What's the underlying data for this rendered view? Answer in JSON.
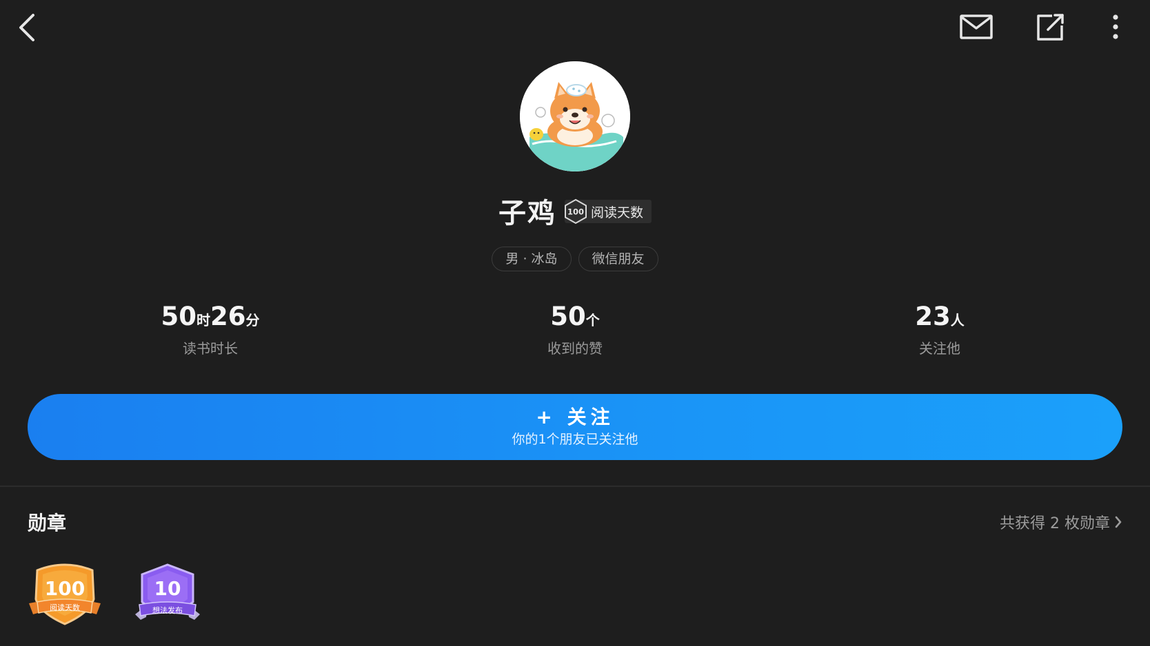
{
  "topbar": {
    "back_icon": "chevron-left-icon",
    "mail_icon": "mail-icon",
    "share_icon": "share-external-icon",
    "more_icon": "more-vertical-icon"
  },
  "profile": {
    "name": "子鸡",
    "badge_number": "100",
    "badge_label": "阅读天数",
    "tags": [
      "男 · 冰岛",
      "微信朋友"
    ]
  },
  "stats": [
    {
      "value1": "50",
      "unit1": "时",
      "value2": "26",
      "unit2": "分",
      "label": "读书时长"
    },
    {
      "value1": "50",
      "unit1": "个",
      "label": "收到的赞"
    },
    {
      "value1": "23",
      "unit1": "人",
      "label": "关注他"
    }
  ],
  "follow": {
    "label": "+ 关注",
    "subtitle": "你的1个朋友已关注他"
  },
  "medals": {
    "title": "勋章",
    "summary": "共获得 2 枚勋章",
    "items": [
      {
        "number": "100",
        "label": "阅读天数",
        "color": "#f59a2a"
      },
      {
        "number": "10",
        "label": "想法发布",
        "color": "#8a5cf0"
      }
    ]
  },
  "colors": {
    "background": "#1e1e1e",
    "accent": "#1a8cf5"
  }
}
